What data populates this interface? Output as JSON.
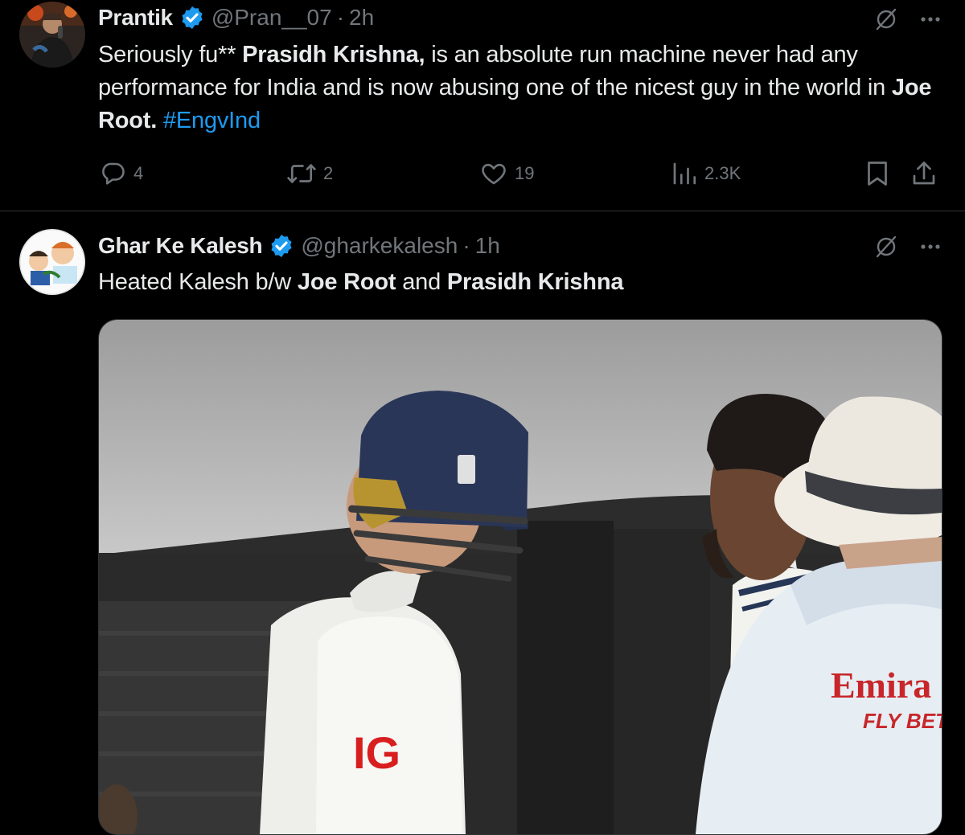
{
  "tweets": [
    {
      "author": {
        "name": "Prantik",
        "handle": "@Pran__07",
        "time": "2h"
      },
      "text": {
        "p1": "Seriously fu** ",
        "b1": "Prasidh Krishna,",
        "p2": " is an absolute run machine never had any performance for India and is now abusing one of the nicest guy in the world in ",
        "b2": "Joe Root.",
        "p3": " ",
        "hashtag": "#EngvInd"
      },
      "stats": {
        "replies": "4",
        "reposts": "2",
        "likes": "19",
        "views": "2.3K"
      }
    },
    {
      "author": {
        "name": "Ghar Ke Kalesh",
        "handle": "@gharkekalesh",
        "time": "1h"
      },
      "text": {
        "p1": "Heated Kalesh b/w ",
        "b1": "Joe Root",
        "p2": " and ",
        "b2": "Prasidh Krishna"
      },
      "media": {
        "shirt_logo": "IG",
        "sponsor_line1": "Emira",
        "sponsor_line2": "FLY BET"
      }
    }
  ],
  "icons": [
    "verified-badge-icon",
    "grok-icon",
    "more-icon",
    "reply-icon",
    "repost-icon",
    "like-icon",
    "views-icon",
    "bookmark-icon",
    "share-icon"
  ],
  "colors": {
    "accent": "#1d9bf0",
    "muted": "#71767b",
    "text": "#e7e9ea",
    "divider": "#2f3336"
  }
}
